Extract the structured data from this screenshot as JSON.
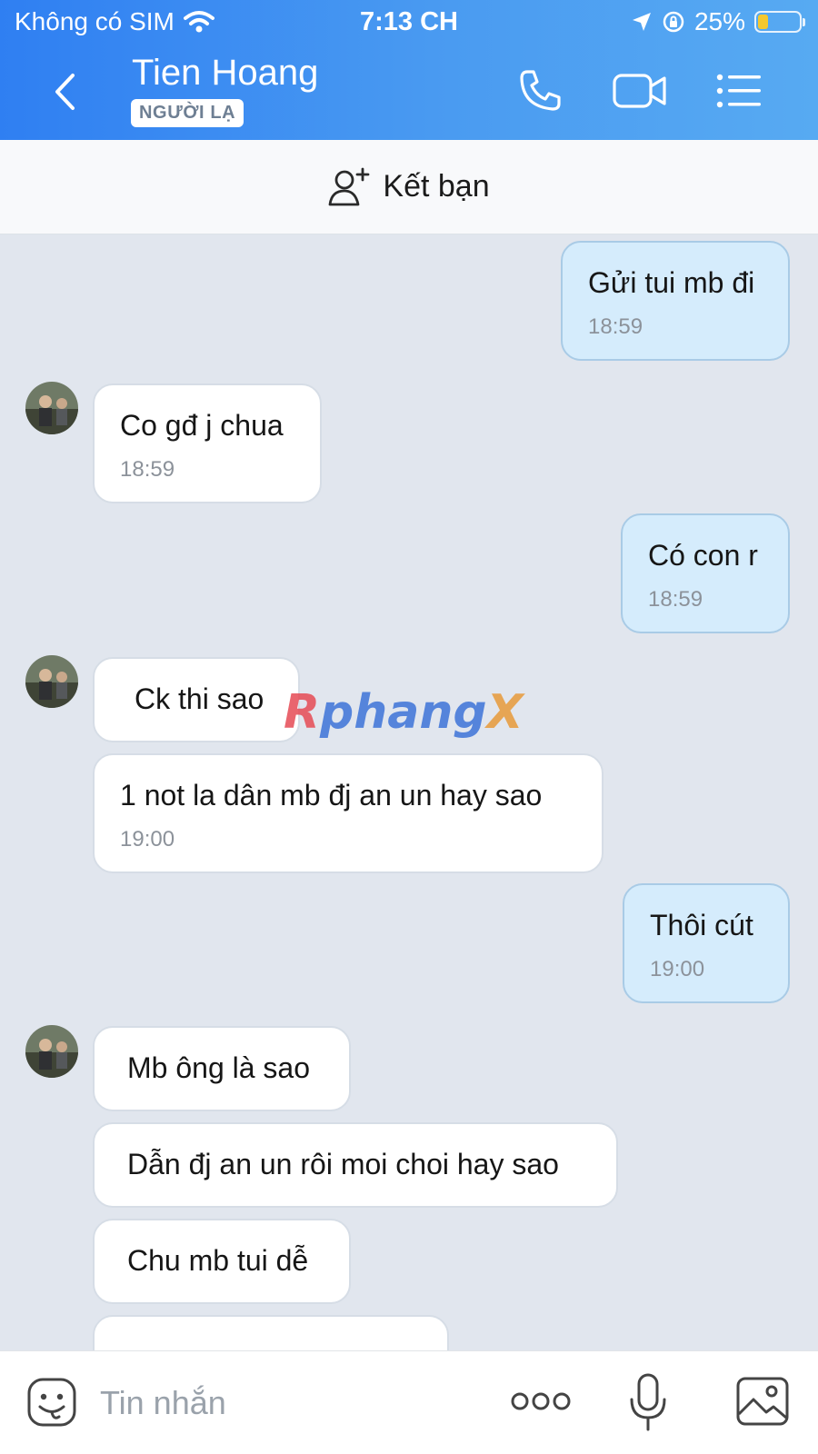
{
  "status_bar": {
    "carrier": "Không có SIM",
    "time": "7:13 CH",
    "battery_percent": "25%",
    "battery_level": 0.25,
    "icons": [
      "wifi-icon",
      "location-icon",
      "rotation-lock-icon",
      "battery-icon"
    ]
  },
  "header": {
    "contact_name": "Tien Hoang",
    "badge": "NGƯỜI LẠ",
    "icons": [
      "back-icon",
      "phone-icon",
      "video-call-icon",
      "menu-list-icon"
    ]
  },
  "friend_bar": {
    "label": "Kết bạn",
    "icon": "add-friend-icon"
  },
  "messages": [
    {
      "side": "out",
      "text": "Gửi tui mb đi",
      "time": "18:59"
    },
    {
      "side": "in",
      "text": "Co gđ j chua",
      "time": "18:59"
    },
    {
      "side": "out",
      "text": "Có con r",
      "time": "18:59"
    },
    {
      "side": "in",
      "text": "Ck thi sao",
      "time": ""
    },
    {
      "side": "in",
      "text": "1 not la dân mb đj an un hay  sao",
      "time": "19:00"
    },
    {
      "side": "out",
      "text": "Thôi cút",
      "time": "19:00"
    },
    {
      "side": "in",
      "text": "Mb ông là sao",
      "time": ""
    },
    {
      "side": "in",
      "text": "Dẫn đj an un rôi moi choi hay sao",
      "time": ""
    },
    {
      "side": "in",
      "text": "Chu mb tui dễ",
      "time": ""
    }
  ],
  "watermark": {
    "part1": "R",
    "part2": "phang",
    "part3": "X"
  },
  "input_bar": {
    "placeholder": "Tin nhắn",
    "value": "",
    "icons": [
      "emoji-sticker-icon",
      "more-dots-icon",
      "microphone-icon",
      "image-icon"
    ]
  },
  "colors": {
    "header_gradient_start": "#2f7ff2",
    "header_gradient_end": "#57aaf2",
    "chat_background": "#e1e6ee",
    "outgoing_bubble": "#d5ecfc",
    "incoming_bubble": "#ffffff"
  }
}
